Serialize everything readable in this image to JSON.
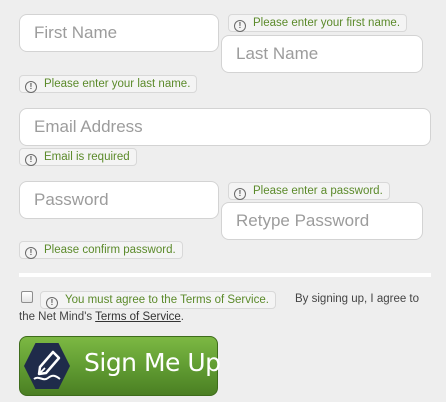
{
  "form": {
    "first_name": {
      "placeholder": "First Name"
    },
    "last_name": {
      "placeholder": "Last Name"
    },
    "email": {
      "placeholder": "Email Address"
    },
    "password": {
      "placeholder": "Password"
    },
    "retype_password": {
      "placeholder": "Retype Password"
    }
  },
  "errors": {
    "first_name": "Please enter your first name.",
    "last_name": "Please enter your last name.",
    "email": "Email is required",
    "password": "Please enter a password.",
    "confirm": "Please confirm password.",
    "terms": "You must agree to the Terms of Service."
  },
  "agreement": {
    "text_line1": "By signing up, I agree to",
    "text_prefix": "the Net Mind's",
    "terms_link": "Terms of Service",
    "text_suffix": "."
  },
  "signup_button": {
    "label": "Sign Me Up"
  },
  "icons": {
    "error": "exclamation-circle-icon",
    "signup": "pen-nib-icon"
  },
  "colors": {
    "error_text": "#5b8a2a",
    "button_green": "#5f9a31",
    "pen_badge": "#1f2b4a"
  }
}
